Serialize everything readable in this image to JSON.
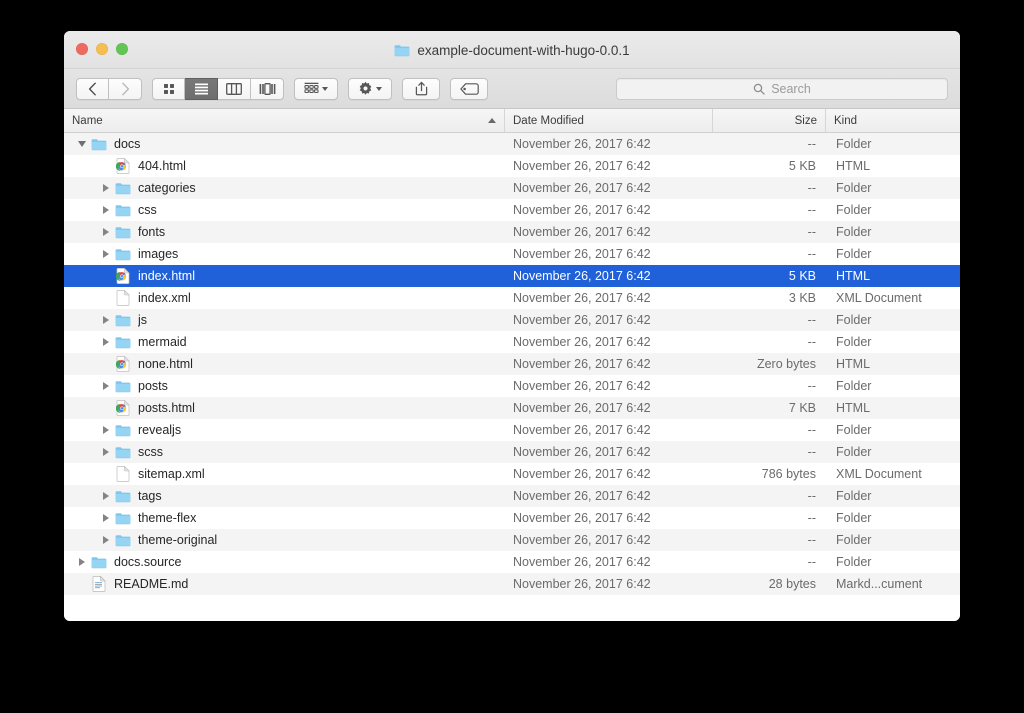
{
  "window": {
    "title": "example-document-with-hugo-0.0.1",
    "title_icon": "folder-icon",
    "traffic_lights": [
      {
        "name": "close",
        "color": "#ec6a5f"
      },
      {
        "name": "minimize",
        "color": "#f4bf50"
      },
      {
        "name": "zoom",
        "color": "#61c554"
      }
    ]
  },
  "toolbar": {
    "back_icon": "chevron-left-icon",
    "forward_icon": "chevron-right-icon",
    "view_modes": [
      {
        "name": "icon-view",
        "icon": "grid-icon",
        "active": false
      },
      {
        "name": "list-view",
        "icon": "list-icon",
        "active": true
      },
      {
        "name": "column-view",
        "icon": "columns-icon",
        "active": false
      },
      {
        "name": "gallery-view",
        "icon": "coverflow-icon",
        "active": false
      }
    ],
    "arrange_icon": "arrange-grid-icon",
    "action_icon": "gear-icon",
    "share_icon": "share-icon",
    "tags_icon": "tag-icon"
  },
  "search": {
    "icon": "search-icon",
    "placeholder": "Search",
    "value": ""
  },
  "columns": {
    "name": "Name",
    "date_modified": "Date Modified",
    "size": "Size",
    "kind": "Kind",
    "sort_column": "Name",
    "sort_direction": "ascending"
  },
  "selection_color": "#2060d8",
  "files": [
    {
      "name": "docs",
      "date": "November 26, 2017 6:42",
      "size": "--",
      "kind": "Folder",
      "icon": "folder-icon",
      "depth": 0,
      "disclosure": "open",
      "selected": false
    },
    {
      "name": "404.html",
      "date": "November 26, 2017 6:42",
      "size": "5 KB",
      "kind": "HTML",
      "icon": "html-file-icon",
      "depth": 1,
      "disclosure": "none",
      "selected": false
    },
    {
      "name": "categories",
      "date": "November 26, 2017 6:42",
      "size": "--",
      "kind": "Folder",
      "icon": "folder-icon",
      "depth": 1,
      "disclosure": "closed",
      "selected": false
    },
    {
      "name": "css",
      "date": "November 26, 2017 6:42",
      "size": "--",
      "kind": "Folder",
      "icon": "folder-icon",
      "depth": 1,
      "disclosure": "closed",
      "selected": false
    },
    {
      "name": "fonts",
      "date": "November 26, 2017 6:42",
      "size": "--",
      "kind": "Folder",
      "icon": "folder-icon",
      "depth": 1,
      "disclosure": "closed",
      "selected": false
    },
    {
      "name": "images",
      "date": "November 26, 2017 6:42",
      "size": "--",
      "kind": "Folder",
      "icon": "folder-icon",
      "depth": 1,
      "disclosure": "closed",
      "selected": false
    },
    {
      "name": "index.html",
      "date": "November 26, 2017 6:42",
      "size": "5 KB",
      "kind": "HTML",
      "icon": "html-file-icon",
      "depth": 1,
      "disclosure": "none",
      "selected": true
    },
    {
      "name": "index.xml",
      "date": "November 26, 2017 6:42",
      "size": "3 KB",
      "kind": "XML Document",
      "icon": "blank-file-icon",
      "depth": 1,
      "disclosure": "none",
      "selected": false
    },
    {
      "name": "js",
      "date": "November 26, 2017 6:42",
      "size": "--",
      "kind": "Folder",
      "icon": "folder-icon",
      "depth": 1,
      "disclosure": "closed",
      "selected": false
    },
    {
      "name": "mermaid",
      "date": "November 26, 2017 6:42",
      "size": "--",
      "kind": "Folder",
      "icon": "folder-icon",
      "depth": 1,
      "disclosure": "closed",
      "selected": false
    },
    {
      "name": "none.html",
      "date": "November 26, 2017 6:42",
      "size": "Zero bytes",
      "kind": "HTML",
      "icon": "html-file-icon",
      "depth": 1,
      "disclosure": "none",
      "selected": false
    },
    {
      "name": "posts",
      "date": "November 26, 2017 6:42",
      "size": "--",
      "kind": "Folder",
      "icon": "folder-icon",
      "depth": 1,
      "disclosure": "closed",
      "selected": false
    },
    {
      "name": "posts.html",
      "date": "November 26, 2017 6:42",
      "size": "7 KB",
      "kind": "HTML",
      "icon": "html-file-icon",
      "depth": 1,
      "disclosure": "none",
      "selected": false
    },
    {
      "name": "revealjs",
      "date": "November 26, 2017 6:42",
      "size": "--",
      "kind": "Folder",
      "icon": "folder-icon",
      "depth": 1,
      "disclosure": "closed",
      "selected": false
    },
    {
      "name": "scss",
      "date": "November 26, 2017 6:42",
      "size": "--",
      "kind": "Folder",
      "icon": "folder-icon",
      "depth": 1,
      "disclosure": "closed",
      "selected": false
    },
    {
      "name": "sitemap.xml",
      "date": "November 26, 2017 6:42",
      "size": "786 bytes",
      "kind": "XML Document",
      "icon": "blank-file-icon",
      "depth": 1,
      "disclosure": "none",
      "selected": false
    },
    {
      "name": "tags",
      "date": "November 26, 2017 6:42",
      "size": "--",
      "kind": "Folder",
      "icon": "folder-icon",
      "depth": 1,
      "disclosure": "closed",
      "selected": false
    },
    {
      "name": "theme-flex",
      "date": "November 26, 2017 6:42",
      "size": "--",
      "kind": "Folder",
      "icon": "folder-icon",
      "depth": 1,
      "disclosure": "closed",
      "selected": false
    },
    {
      "name": "theme-original",
      "date": "November 26, 2017 6:42",
      "size": "--",
      "kind": "Folder",
      "icon": "folder-icon",
      "depth": 1,
      "disclosure": "closed",
      "selected": false
    },
    {
      "name": "docs.source",
      "date": "November 26, 2017 6:42",
      "size": "--",
      "kind": "Folder",
      "icon": "folder-icon",
      "depth": 0,
      "disclosure": "closed",
      "selected": false
    },
    {
      "name": "README.md",
      "date": "November 26, 2017 6:42",
      "size": "28 bytes",
      "kind": "Markd...cument",
      "icon": "markdown-file-icon",
      "depth": 0,
      "disclosure": "none",
      "selected": false
    }
  ]
}
